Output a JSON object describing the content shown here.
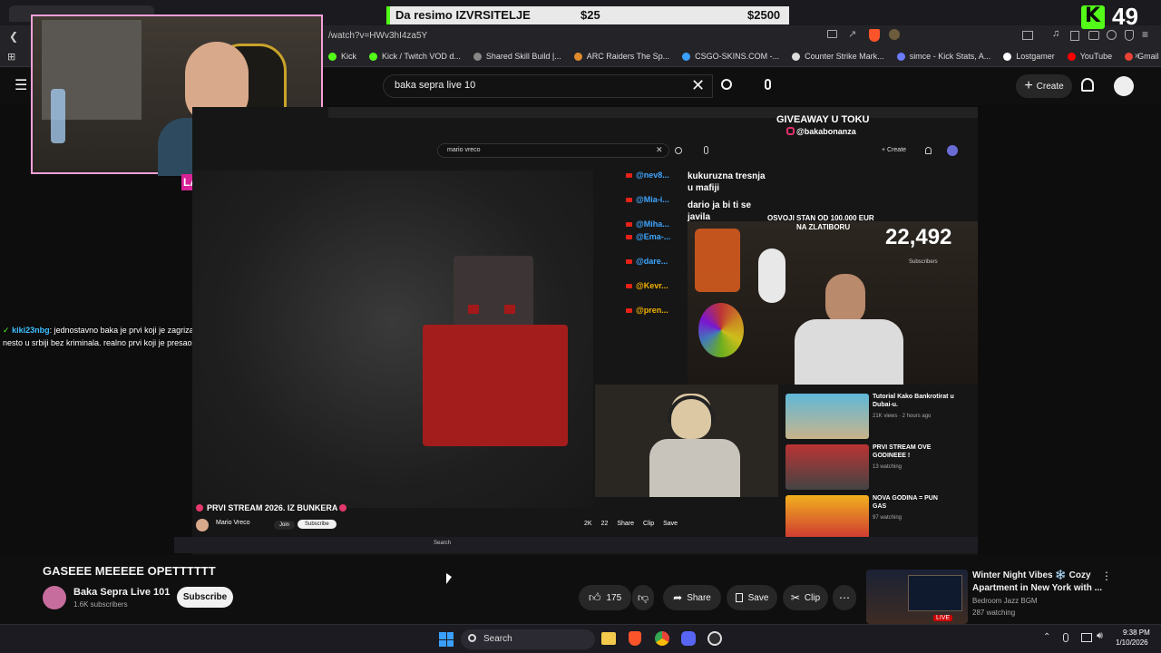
{
  "browser": {
    "url": "/watch?v=HWv3hI4za5Y",
    "bookmarks": [
      {
        "label": "Kick",
        "color": "#53fc18"
      },
      {
        "label": "Kick / Twitch VOD d...",
        "color": "#53fc18"
      },
      {
        "label": "Shared Skill Build |...",
        "color": "#888888"
      },
      {
        "label": "ARC Raiders The Sp...",
        "color": "#e08a2c"
      },
      {
        "label": "CSGO-SKINS.COM -...",
        "color": "#3aa0ff"
      },
      {
        "label": "Counter Strike Mark...",
        "color": "#dddddd"
      },
      {
        "label": "simce - Kick Stats, A...",
        "color": "#6b7cff"
      },
      {
        "label": "Lostgamer",
        "color": "#ffffff"
      },
      {
        "label": "YouTube",
        "color": "#ff0000"
      },
      {
        "label": "Gmail",
        "color": "#ea4335"
      }
    ]
  },
  "overlay": {
    "banner_title": "Da resimo IZVRSITELJE",
    "banner_left_amount": "$25",
    "banner_right_amount": "$2500",
    "kick_count": "49",
    "cam_tag": "LA",
    "chat_user": "kiki23nbg",
    "chat_text_1": ": jednostavno baka je prvi koji je zagrizao na yt i uspeo",
    "chat_text_2": "nesto u srbiji bez kriminala. realno prvi koji je presao igricu na balkanu"
  },
  "youtube": {
    "search_query": "baka sepra live 10",
    "create_label": "Create",
    "video_title": "GASEEE MEEEEE OPETTTTTT",
    "channel_name": "Baka Sepra Live 101",
    "subscribers": "1.6K subscribers",
    "subscribe_label": "Subscribe",
    "likes": "175",
    "share_label": "Share",
    "save_label": "Save",
    "clip_label": "Clip",
    "recommended": {
      "title_1": "Winter Night Vibes ❄️ Cozy",
      "title_2": "Apartment in New York with ...",
      "channel": "Bedroom Jazz BGM",
      "watching": "287 watching",
      "badge": "LIVE"
    }
  },
  "inner_stream": {
    "giveaway_title": "GIVEAWAY U TOKU",
    "giveaway_handle": "@bakabonanza",
    "search_query": "mario vreco",
    "stream_title": "PRVI STREAM 2026. IZ BUNKERA",
    "channel": "Mario Vreco",
    "subscriber_count": "22,492",
    "subscriber_label": "Subscribers",
    "overlay_line_1": "OSVOJI STAN OD 100.000 EUR",
    "overlay_line_2": "NA ZLATIBORU",
    "chat_names": [
      "@nev8...",
      "@Mia-i...",
      "@Miha...",
      "@Ema-...",
      "@dare...",
      "@Kevr...",
      "@pren..."
    ],
    "chat_msg_1a": "kukuruzna tresnja",
    "chat_msg_1b": "u mafiji",
    "chat_msg_2a": "dario ja bi ti se",
    "chat_msg_2b": "javila",
    "sidebar": [
      {
        "title": "Tutorial Kako Bankrotirat u",
        "title2": "Dubai-u.",
        "meta": "21K views · 2 hours ago"
      },
      {
        "title": "PRVI STREAM OVE",
        "title2": "GODINEEE !",
        "meta": "13 watching"
      },
      {
        "title": "NOVA GODINA = PUN",
        "title2": "GAS",
        "meta": "97 watching"
      }
    ],
    "likes": "2K",
    "dislikes": "22",
    "share": "Share",
    "clip": "Clip",
    "save": "Save",
    "join": "Join",
    "subscribe": "Subscribe",
    "taskbar_search": "Search"
  },
  "taskbar": {
    "search_label": "Search",
    "time": "9:38 PM",
    "date": "1/10/2026"
  }
}
